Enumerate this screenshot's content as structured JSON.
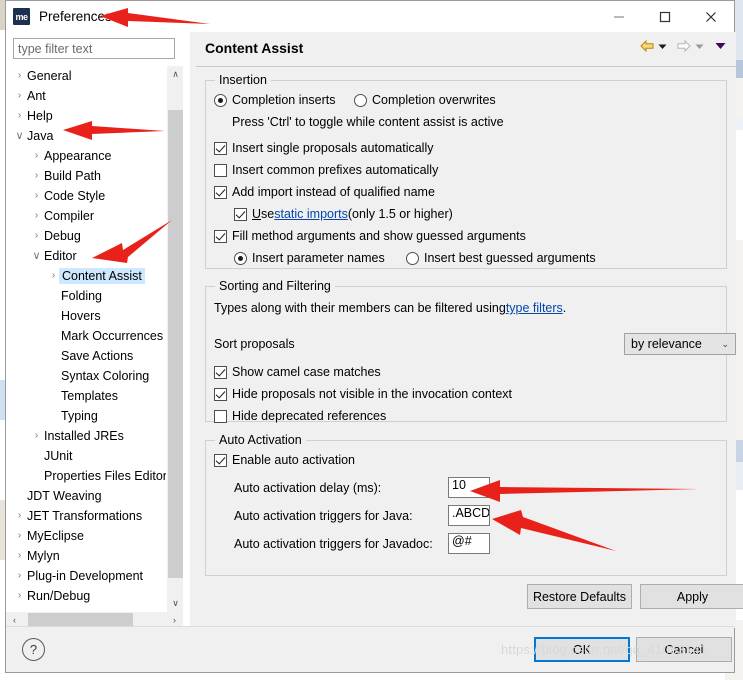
{
  "window": {
    "app_icon_text": "me",
    "title": "Preferences",
    "minimize_label": "—",
    "maximize_label": "□",
    "close_label": "✕"
  },
  "sidebar": {
    "filter_placeholder": "type filter text",
    "filter_value": "",
    "items": [
      {
        "label": "General",
        "indent": 0,
        "twisty": "collapsed"
      },
      {
        "label": "Ant",
        "indent": 0,
        "twisty": "collapsed"
      },
      {
        "label": "Help",
        "indent": 0,
        "twisty": "collapsed"
      },
      {
        "label": "Java",
        "indent": 0,
        "twisty": "expanded"
      },
      {
        "label": "Appearance",
        "indent": 1,
        "twisty": "collapsed"
      },
      {
        "label": "Build Path",
        "indent": 1,
        "twisty": "collapsed"
      },
      {
        "label": "Code Style",
        "indent": 1,
        "twisty": "collapsed"
      },
      {
        "label": "Compiler",
        "indent": 1,
        "twisty": "collapsed"
      },
      {
        "label": "Debug",
        "indent": 1,
        "twisty": "collapsed"
      },
      {
        "label": "Editor",
        "indent": 1,
        "twisty": "expanded"
      },
      {
        "label": "Content Assist",
        "indent": 2,
        "twisty": "collapsed",
        "selected": true
      },
      {
        "label": "Folding",
        "indent": 2,
        "twisty": "none"
      },
      {
        "label": "Hovers",
        "indent": 2,
        "twisty": "none"
      },
      {
        "label": "Mark Occurrences",
        "indent": 2,
        "twisty": "none"
      },
      {
        "label": "Save Actions",
        "indent": 2,
        "twisty": "none"
      },
      {
        "label": "Syntax Coloring",
        "indent": 2,
        "twisty": "none"
      },
      {
        "label": "Templates",
        "indent": 2,
        "twisty": "none"
      },
      {
        "label": "Typing",
        "indent": 2,
        "twisty": "none"
      },
      {
        "label": "Installed JREs",
        "indent": 1,
        "twisty": "collapsed"
      },
      {
        "label": "JUnit",
        "indent": 1,
        "twisty": "none"
      },
      {
        "label": "Properties Files Editor",
        "indent": 1,
        "twisty": "none"
      },
      {
        "label": "JDT Weaving",
        "indent": 0,
        "twisty": "none"
      },
      {
        "label": "JET Transformations",
        "indent": 0,
        "twisty": "collapsed"
      },
      {
        "label": "MyEclipse",
        "indent": 0,
        "twisty": "collapsed"
      },
      {
        "label": "Mylyn",
        "indent": 0,
        "twisty": "collapsed"
      },
      {
        "label": "Plug-in Development",
        "indent": 0,
        "twisty": "collapsed"
      },
      {
        "label": "Run/Debug",
        "indent": 0,
        "twisty": "collapsed"
      }
    ],
    "scroll_up_glyph": "∧",
    "scroll_down_glyph": "∨",
    "scroll_left_glyph": "‹",
    "scroll_right_glyph": "›"
  },
  "page": {
    "title": "Content Assist",
    "nav": {
      "back_icon": "back-arrow-icon",
      "back_menu_icon": "dropdown-triangle-icon",
      "forward_icon": "forward-arrow-icon",
      "forward_menu_icon": "dropdown-triangle-icon",
      "view_menu_icon": "view-menu-triangle-icon"
    }
  },
  "insertion": {
    "group_title": "Insertion",
    "completion_inserts": {
      "label": "Completion inserts",
      "checked": true
    },
    "completion_overwrites": {
      "label": "Completion overwrites",
      "checked": false
    },
    "hint": "Press 'Ctrl' to toggle while content assist is active",
    "insert_single_proposals": {
      "label": "Insert single proposals automatically",
      "checked": true
    },
    "insert_common_prefixes": {
      "label": "Insert common prefixes automatically",
      "checked": false
    },
    "add_import": {
      "label": "Add import instead of qualified name",
      "checked": true
    },
    "use_static_imports": {
      "prefix_mnemonic": "U",
      "prefix_rest": "se ",
      "link": "static imports",
      "suffix": " (only 1.5 or higher)",
      "checked": true
    },
    "fill_method_arguments": {
      "label": "Fill method arguments and show guessed arguments",
      "checked": true
    },
    "insert_parameter_names": {
      "label": "Insert parameter names",
      "checked": true
    },
    "insert_best_guessed": {
      "label": "Insert best guessed arguments",
      "checked": false
    }
  },
  "sorting": {
    "group_title": "Sorting and Filtering",
    "description_prefix": "Types along with their members can be filtered using ",
    "description_link": "type filters",
    "description_suffix": ".",
    "sort_proposals_label": "Sort proposals",
    "sort_proposals_value": "by relevance",
    "combo_arrow": "⌄",
    "show_camel_case": {
      "label": "Show camel case matches",
      "checked": true
    },
    "hide_not_visible": {
      "label": "Hide proposals not visible in the invocation context",
      "checked": true
    },
    "hide_deprecated": {
      "label": "Hide deprecated references",
      "checked": false
    }
  },
  "auto_activation": {
    "group_title": "Auto Activation",
    "enable": {
      "label": "Enable auto activation",
      "checked": true
    },
    "delay_label": "Auto activation delay (ms):",
    "delay_value": "10",
    "java_triggers_label": "Auto activation triggers for Java:",
    "java_triggers_value": ".ABCD",
    "javadoc_triggers_label": "Auto activation triggers for Javadoc:",
    "javadoc_triggers_value": "@#"
  },
  "page_buttons": {
    "restore_defaults": "Restore Defaults",
    "apply": "Apply"
  },
  "footer": {
    "help_glyph": "?",
    "ok": "OK",
    "cancel": "Cancel",
    "watermark": "https://blog.csdn.net/qq_41063141"
  },
  "annotations": {
    "color": "#e8221b",
    "arrows": [
      "arrow-to-preferences-title",
      "arrow-to-java-node",
      "arrow-to-editor-node",
      "arrow-to-delay-field",
      "arrow-to-java-triggers-field"
    ]
  }
}
